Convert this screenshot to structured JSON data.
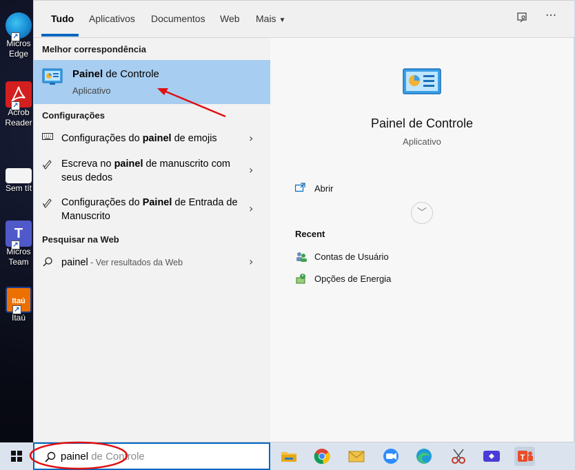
{
  "desktop": {
    "icons": [
      {
        "label": "Micros Edge",
        "line1": "Micros",
        "line2": "Edge"
      },
      {
        "label": "Acrob Reader",
        "line1": "Acrob",
        "line2": "Reader"
      },
      {
        "label": "Sem tít",
        "line1": "Sem tít",
        "line2": ""
      },
      {
        "label": "Micros Team",
        "line1": "Micros",
        "line2": "Team"
      },
      {
        "label": "Itaú",
        "line1": "Itaú",
        "line2": ""
      }
    ],
    "itau_logo_text": "Itaú"
  },
  "tabs": [
    {
      "label": "Tudo"
    },
    {
      "label": "Aplicativos"
    },
    {
      "label": "Documentos"
    },
    {
      "label": "Web"
    },
    {
      "label": "Mais"
    }
  ],
  "top_icons": {
    "feedback": "feedback-icon",
    "more": "···"
  },
  "left": {
    "best_match_title": "Melhor correspondência",
    "best_match": {
      "bold": "Painel",
      "rest": " de Controle",
      "subtitle": "Aplicativo"
    },
    "settings_title": "Configurações",
    "settings": [
      {
        "pre": "Configurações do ",
        "bold": "painel",
        "post": " de emojis",
        "icon": "keyboard-icon"
      },
      {
        "pre": "Escreva no ",
        "bold": "painel",
        "post": " de manuscrito com seus dedos",
        "icon": "pen-icon"
      },
      {
        "pre": "Configurações do ",
        "bold": "Painel",
        "post": " de Entrada de Manuscrito",
        "icon": "pen-icon"
      }
    ],
    "web_title": "Pesquisar na Web",
    "web": {
      "query": "painel",
      "suffix": " - Ver resultados da Web"
    }
  },
  "right": {
    "app_name": "Painel de Controle",
    "app_type": "Aplicativo",
    "open_label": "Abrir",
    "recent_title": "Recent",
    "recent": [
      {
        "label": "Contas de Usuário",
        "icon": "user-accounts-icon"
      },
      {
        "label": "Opções de Energia",
        "icon": "power-options-icon"
      }
    ]
  },
  "taskbar": {
    "search_typed": "painel",
    "search_ghost": " de Controle",
    "apps": [
      "file-explorer",
      "chrome",
      "outlook-mail",
      "zoom",
      "edge",
      "snipping-tool",
      "remote-app",
      "teams"
    ]
  },
  "colors": {
    "accent": "#0067c0",
    "best_match_bg": "#a7cdf0",
    "annotation": "#e01010"
  }
}
